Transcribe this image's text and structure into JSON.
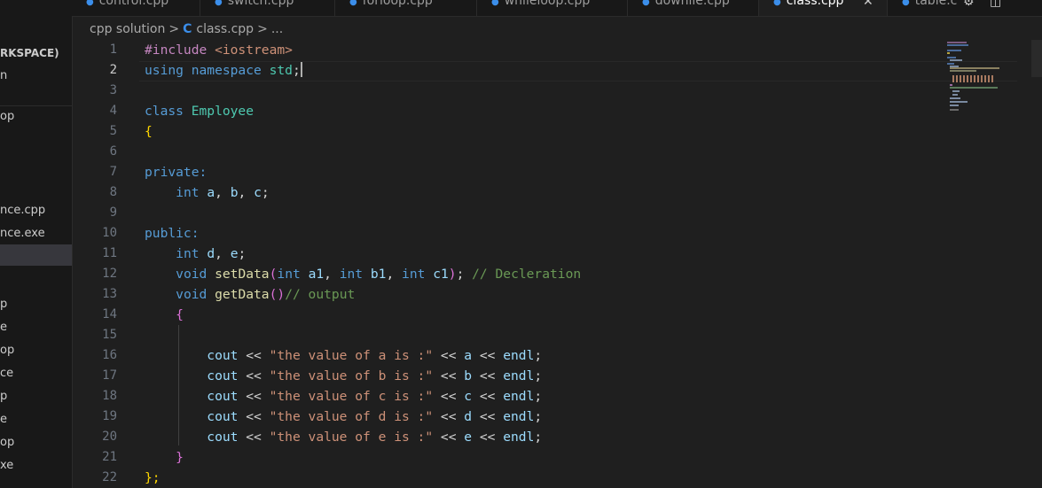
{
  "sidebar": {
    "header": "RKSPACE)",
    "items": [
      {
        "label": "n"
      },
      {
        "label": "op"
      },
      {
        "label": "nce.cpp"
      },
      {
        "label": "nce.exe"
      },
      {
        "label": ""
      },
      {
        "label": "p"
      },
      {
        "label": "e"
      },
      {
        "label": "op"
      },
      {
        "label": "ce"
      },
      {
        "label": "p"
      },
      {
        "label": "e"
      },
      {
        "label": "op"
      },
      {
        "label": "xe"
      }
    ]
  },
  "tabs": [
    {
      "label": "control.cpp"
    },
    {
      "label": "switch.cpp"
    },
    {
      "label": "forloop.cpp"
    },
    {
      "label": "whileloop.cpp"
    },
    {
      "label": "dowhile.cpp"
    },
    {
      "label": "class.cpp"
    },
    {
      "label": "table.c"
    }
  ],
  "tab_close_glyph": "✕",
  "breadcrumb": {
    "folder": "cpp solution",
    "sep": ">",
    "file_icon": "C",
    "file": "class.cpp",
    "more": "..."
  },
  "editor": {
    "line_numbers": [
      "1",
      "2",
      "3",
      "4",
      "5",
      "6",
      "7",
      "8",
      "9",
      "10",
      "11",
      "12",
      "13",
      "14",
      "15",
      "16",
      "17",
      "18",
      "19",
      "20",
      "21",
      "22"
    ],
    "current_line": "2",
    "code": {
      "l1a": "#include ",
      "l1b": "<iostream>",
      "l2a": "using ",
      "l2b": "namespace ",
      "l2c": "std",
      "l2d": ";",
      "l4a": "class ",
      "l4b": "Employee",
      "l5": "{",
      "l7": "private:",
      "l8a": "int ",
      "l8b": "a",
      "l8c": ", ",
      "l8d": "b",
      "l8e": ", ",
      "l8f": "c",
      "l8g": ";",
      "l10": "public:",
      "l11a": "int ",
      "l11b": "d",
      "l11c": ", ",
      "l11d": "e",
      "l11e": ";",
      "l12a": "void ",
      "l12b": "setData",
      "l12c": "(",
      "l12d": "int ",
      "l12e": "a1",
      "l12f": ", ",
      "l12g": "int ",
      "l12h": "b1",
      "l12i": ", ",
      "l12j": "int ",
      "l12k": "c1",
      "l12l": ")",
      "l12m": "; ",
      "l12n": "// Decleration",
      "l13a": "void ",
      "l13b": "getData",
      "l13c": "()",
      "l13d": "// output",
      "l14": "{",
      "cout": "cout",
      "shl": " << ",
      "endl": "endl",
      "semi": ";",
      "s16": "\"the value of a is :\"",
      "v16": "a",
      "s17": "\"the value of b is :\"",
      "v17": "b",
      "s18": "\"the value of c is :\"",
      "v18": "c",
      "s19": "\"the value of d is :\"",
      "v19": "d",
      "s20": "\"the value of e is :\"",
      "v20": "e",
      "l21": "}",
      "l22": "};"
    }
  },
  "colors": {
    "background": "#1f1f1f",
    "keyword": "#569cd6",
    "type": "#4ec9b0",
    "function": "#dcdcaa",
    "variable": "#9cdcfe",
    "string": "#ce9178",
    "comment": "#6a9955",
    "bracket": "#ffd700"
  }
}
